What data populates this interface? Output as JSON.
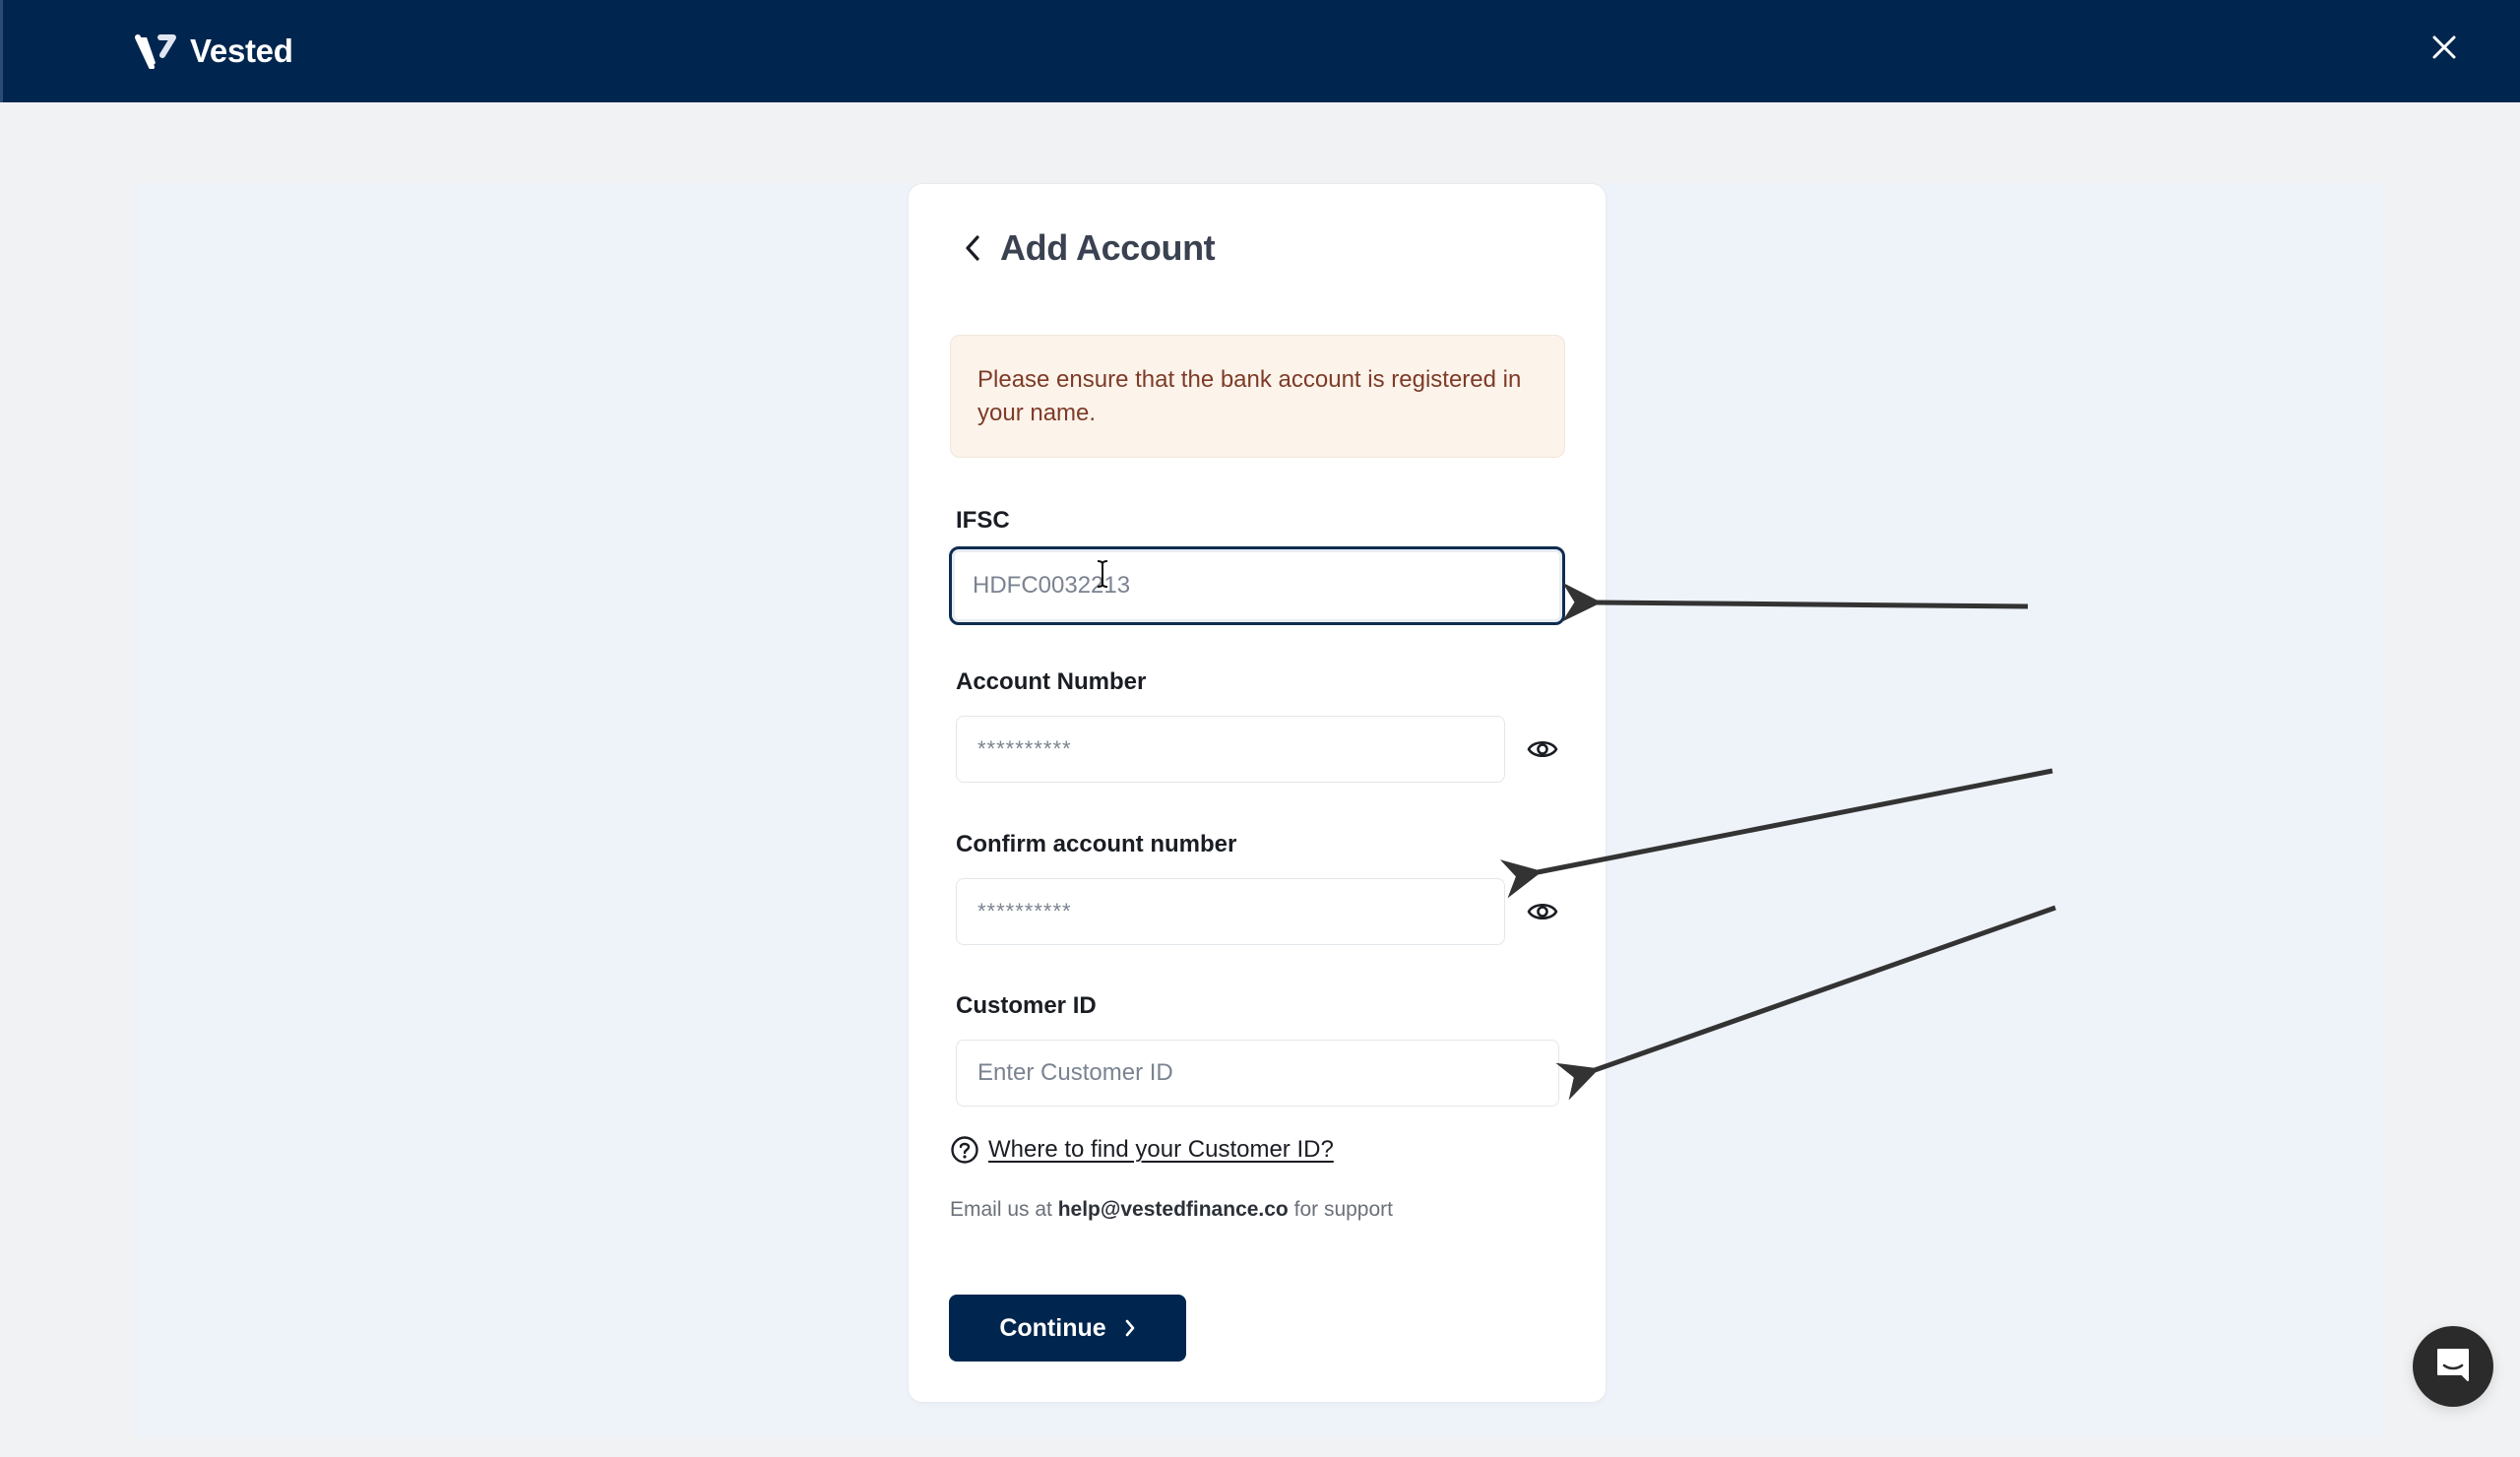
{
  "header": {
    "brand_name": "Vested",
    "logo_icon": "vested-v-logo",
    "close_icon": "close-icon",
    "bg_color": "#00264f"
  },
  "page": {
    "title": "Add Account",
    "back_icon": "chevron-left-icon"
  },
  "alert": {
    "message": "Please ensure that the bank account is registered in your name.",
    "bg_color": "#fcf3ea",
    "text_color": "#7d3b28"
  },
  "form": {
    "ifsc": {
      "label": "IFSC",
      "value": "",
      "placeholder": "HDFC0032213",
      "focused": true
    },
    "account_number": {
      "label": "Account Number",
      "value": "",
      "placeholder": "**********",
      "toggle_icon": "eye-icon"
    },
    "confirm_account_number": {
      "label": "Confirm account number",
      "value": "",
      "placeholder": "**********",
      "toggle_icon": "eye-icon"
    },
    "customer_id": {
      "label": "Customer ID",
      "value": "",
      "placeholder": "Enter Customer ID"
    }
  },
  "help": {
    "icon": "question-circle-icon",
    "link_text": "Where to find your Customer ID?"
  },
  "support": {
    "prefix": "Email us at",
    "email": "help@vestedfinance.co",
    "suffix": "for support"
  },
  "actions": {
    "continue_label": "Continue",
    "continue_icon": "chevron-right-icon",
    "primary_color": "#00264f"
  },
  "annotations": {
    "arrow_count": 3,
    "targets": [
      "IFSC",
      "Confirm account number",
      "Customer ID"
    ],
    "color": "#333333"
  },
  "chat_widget": {
    "icon": "chat-bubble-icon"
  }
}
